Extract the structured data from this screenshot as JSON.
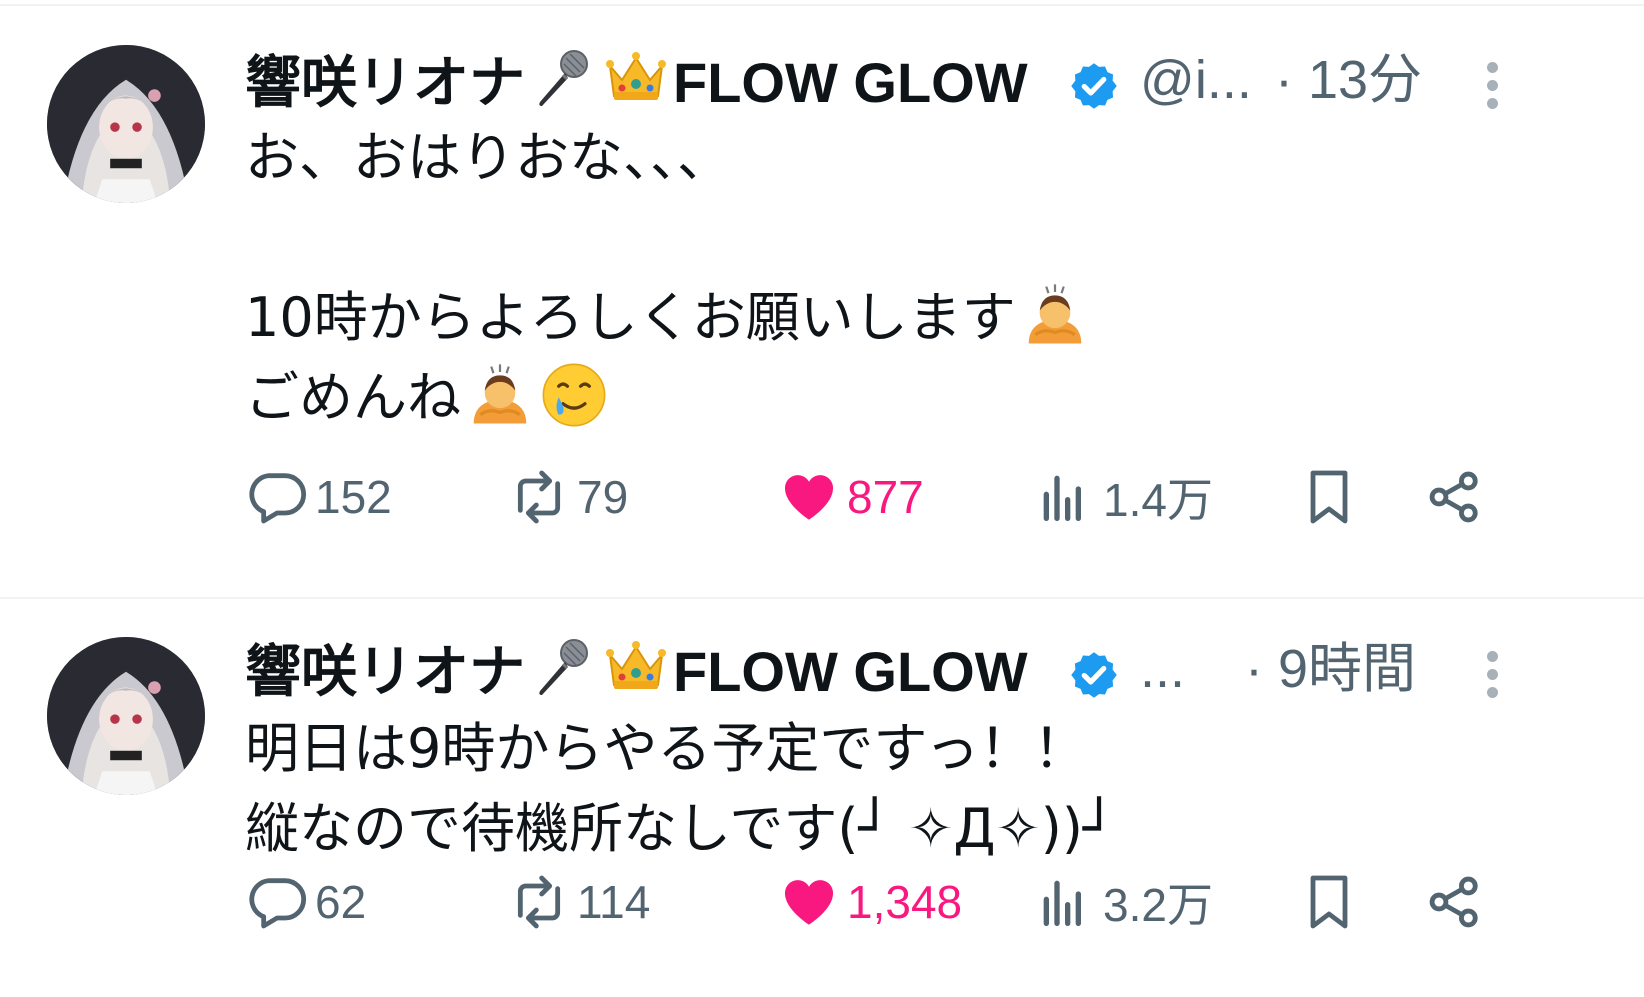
{
  "colors": {
    "text": "#0f1419",
    "secondary": "#536471",
    "like": "#f91880",
    "verified": "#1d9bf0",
    "divider": "#eff3f4"
  },
  "tweets": [
    {
      "author": {
        "display_name": "響咲リオナ",
        "emoji_1": "microphone-emoji",
        "emoji_2": "crown-emoji",
        "display_name_suffix": "FLOW GLOW",
        "verified": true,
        "handle": "@i..."
      },
      "timestamp": "· 13分",
      "body_lines": [
        {
          "text": "お、おはりおな、、、",
          "emojis": []
        },
        {
          "text": "",
          "emojis": []
        },
        {
          "text": "10時からよろしくお願いします",
          "emojis": [
            "person-bowing-emoji"
          ]
        },
        {
          "text": "ごめんね",
          "emojis": [
            "person-bowing-emoji",
            "smiling-face-with-tear-emoji"
          ]
        }
      ],
      "stats": {
        "replies": "152",
        "retweets": "79",
        "likes": "877",
        "views": "1.4万",
        "liked": true
      }
    },
    {
      "author": {
        "display_name": "響咲リオナ",
        "emoji_1": "microphone-emoji",
        "emoji_2": "crown-emoji",
        "display_name_suffix": "FLOW GLOW",
        "verified": true,
        "handle": "..."
      },
      "timestamp": "· 9時間",
      "body_lines": [
        {
          "text": "明日は9時からやる予定ですっ！！",
          "emojis": []
        },
        {
          "text": "縦なので待機所なしです(┘ ✧Д✧))┘",
          "emojis": []
        }
      ],
      "stats": {
        "replies": "62",
        "retweets": "114",
        "likes": "1,348",
        "views": "3.2万",
        "liked": true
      }
    }
  ]
}
